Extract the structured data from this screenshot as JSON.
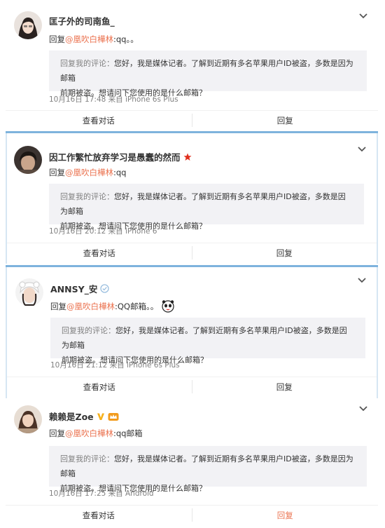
{
  "colors": {
    "accent": "#eb7350",
    "mention": "#eb7350",
    "divider": "#7eb3dd",
    "quote_bg": "#f2f2f5",
    "muted": "#808080"
  },
  "comments": [
    {
      "author": "匡子外的司南鱼_",
      "reply_prefix": "回复",
      "mention": "@凰吹白樺林",
      "reply_text": ":qq。。",
      "quote_label": "回复我的评论：",
      "quote_line1": "您好，我是媒体记者。了解到近期有多名苹果用户ID被盗，多数是因为邮箱",
      "quote_line2": "前期被盗。想请问下您使用的是什么邮箱？",
      "time": "10月16日 17:48 来自 iPhone 6s Plus",
      "action_view": "查看对话",
      "action_reply": "回复",
      "avatar_icon": "avatar-girl-photo"
    },
    {
      "author": "因工作繁忙放弃学习是愚蠢的然而",
      "reply_prefix": "回复",
      "mention": "@凰吹白樺林",
      "reply_text": ":qq",
      "quote_label": "回复我的评论：",
      "quote_line1": "您好，我是媒体记者。了解到近期有多名苹果用户ID被盗，多数是因为邮箱",
      "quote_line2": "前期被盗。想请问下您使用的是什么邮箱？",
      "time": "10月16日 20:12 来自 iPhone 6",
      "action_view": "查看对话",
      "action_reply": "回复",
      "avatar_icon": "avatar-boy-photo",
      "badge_icon": "star-icon"
    },
    {
      "author": "ANNSY_安",
      "reply_prefix": "回复",
      "mention": "@凰吹白樺林",
      "reply_text": ":QQ邮箱。。",
      "quote_label": "回复我的评论：",
      "quote_line1": "您好，我是媒体记者。了解到近期有多名苹果用户ID被盗，多数是因为邮箱",
      "quote_line2": "前期被盗。想请问下您使用的是什么邮箱？",
      "time": "10月16日 21:12 来自 iPhone 6s Plus",
      "action_view": "查看对话",
      "action_reply": "回复",
      "avatar_icon": "avatar-girl-hat-photo",
      "badge_icon": "verified-check-icon",
      "emoji_icon": "panda-emoji-icon"
    },
    {
      "author": "赖赖是Zoe",
      "reply_prefix": "回复",
      "mention": "@凰吹白樺林",
      "reply_text": ":qq邮箱",
      "quote_label": "回复我的评论：",
      "quote_line1": "您好，我是媒体记者。了解到近期有多名苹果用户ID被盗，多数是因为邮箱",
      "quote_line2": "前期被盗。想请问下您使用的是什么邮箱？",
      "time": "10月16日 17:25 来自 Android",
      "action_view": "查看对话",
      "action_reply": "回复",
      "avatar_icon": "avatar-woman-photo",
      "badge_icon": "vip-v-icon",
      "member_icon": "member-crown-icon"
    }
  ]
}
